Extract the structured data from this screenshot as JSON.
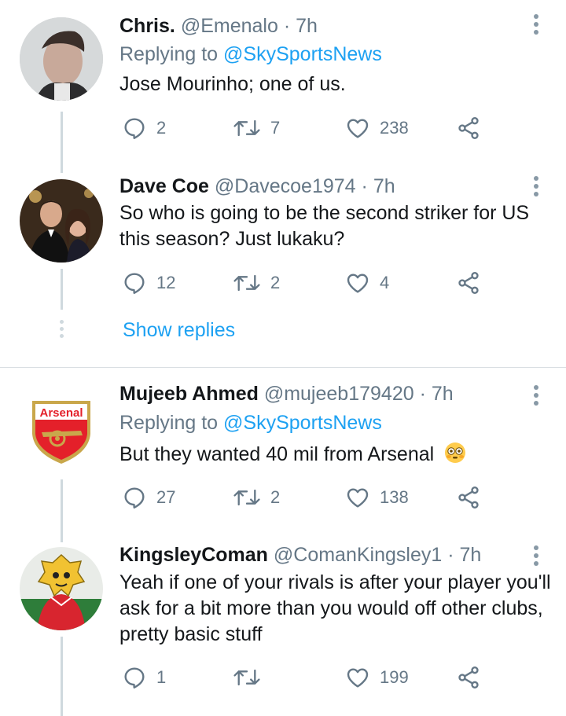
{
  "tweets": [
    {
      "name": "Chris.",
      "handle": "@Emenalo",
      "time": "7h",
      "replying_prefix": "Replying to ",
      "replying_to": "@SkySportsNews",
      "text": "Jose Mourinho; one of us.",
      "replies": "2",
      "retweets": "7",
      "likes": "238"
    },
    {
      "name": "Dave Coe",
      "handle": "@Davecoe1974",
      "time": "7h",
      "text": "So who is going to be the second striker for US this season? Just lukaku?",
      "replies": "12",
      "retweets": "2",
      "likes": "4"
    },
    {
      "name": "Mujeeb Ahmed",
      "handle": "@mujeeb179420",
      "time": "7h",
      "replying_prefix": "Replying to ",
      "replying_to": "@SkySportsNews",
      "text": "But they wanted 40 mil from Arsenal",
      "replies": "27",
      "retweets": "2",
      "likes": "138"
    },
    {
      "name": "KingsleyComan",
      "handle": "@ComanKingsley1",
      "time": "7h",
      "text": "Yeah if one of your rivals is after your player you'll ask for a bit more than you would off other clubs, pretty basic stuff",
      "replies": "1",
      "retweets": "",
      "likes": "199"
    }
  ],
  "show_replies": "Show replies",
  "separator": "·",
  "avatar_logo_text": "Arsenal",
  "colors": {
    "link": "#1da1f2",
    "muted": "#657786",
    "line": "#cfd9de"
  },
  "icons": [
    "reply-icon",
    "retweet-icon",
    "like-icon",
    "share-icon",
    "more-icon"
  ]
}
